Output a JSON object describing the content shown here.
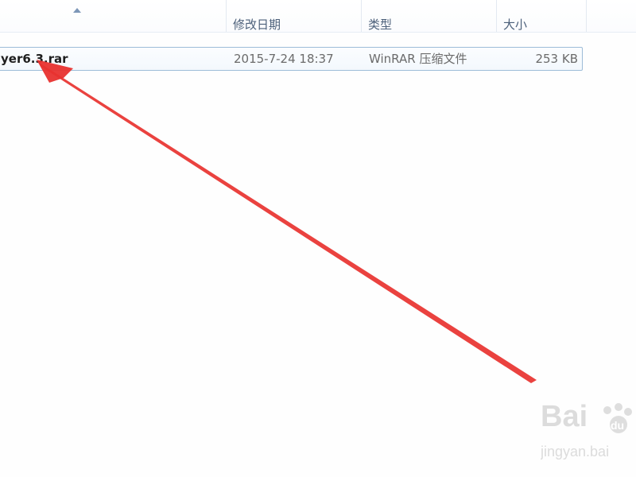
{
  "columns": {
    "date_modified": "修改日期",
    "type": "类型",
    "size": "大小"
  },
  "file": {
    "name": "yer6.3.rar",
    "date_modified": "2015-7-24 18:37",
    "type": "WinRAR 压缩文件",
    "size": "253 KB"
  },
  "annotation": {
    "color": "#e8322f",
    "icon": "red-arrow-icon"
  },
  "watermark": {
    "brand": "Baidu",
    "subtext": "jingyan.baidu"
  }
}
